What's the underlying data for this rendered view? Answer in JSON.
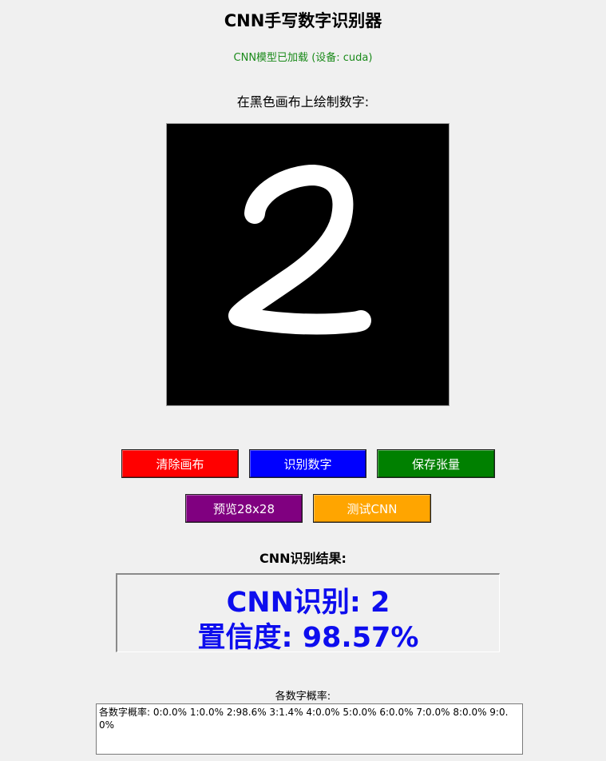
{
  "app": {
    "title": "CNN手写数字识别器",
    "status": "CNN模型已加载 (设备: cuda)",
    "instruction": "在黑色画布上绘制数字:"
  },
  "buttons": {
    "clear": "清除画布",
    "recognize": "识别数字",
    "save": "保存张量",
    "preview": "预览28x28",
    "test": "测试CNN"
  },
  "button_colors": {
    "clear": "#ff0000",
    "recognize": "#0000ff",
    "save": "#008000",
    "preview": "#800080",
    "test": "#ffa500"
  },
  "result": {
    "title": "CNN识别结果:",
    "prediction": "CNN识别: 2",
    "confidence": "置信度: 98.57%"
  },
  "probabilities": {
    "label": "各数字概率:",
    "text": "各数字概率: 0:0.0% 1:0.0% 2:98.6% 3:1.4% 4:0.0% 5:0.0% 6:0.0% 7:0.0% 8:0.0% 9:0.0%"
  }
}
